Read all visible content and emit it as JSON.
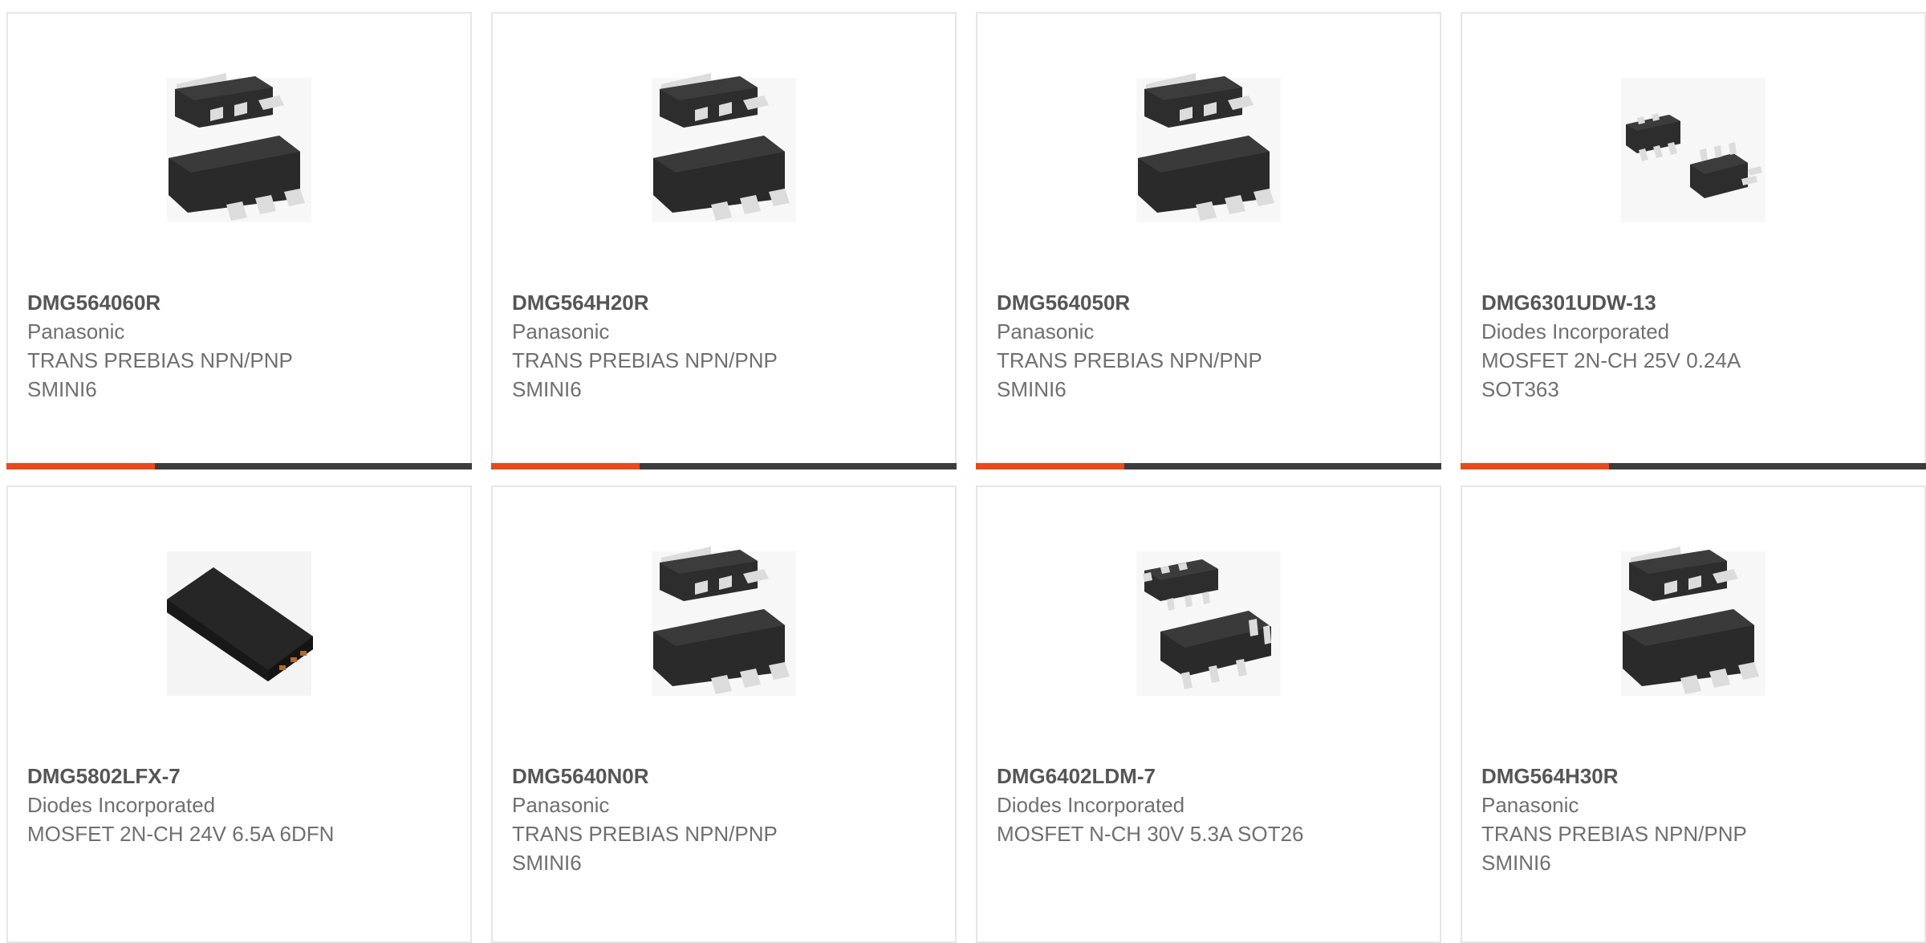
{
  "colors": {
    "accent": "#e8491d",
    "bar_dark": "#3c3c3c",
    "card_border": "#e6e6e6",
    "text_bold": "#555555",
    "text": "#6f6f6f"
  },
  "products": [
    {
      "part_number": "DMG564060R",
      "manufacturer": "Panasonic",
      "description": "TRANS PREBIAS NPN/PNP SMINI6",
      "image_icon": "sot-smini6-package-icon"
    },
    {
      "part_number": "DMG564H20R",
      "manufacturer": "Panasonic",
      "description": "TRANS PREBIAS NPN/PNP SMINI6",
      "image_icon": "sot-smini6-package-icon"
    },
    {
      "part_number": "DMG564050R",
      "manufacturer": "Panasonic",
      "description": "TRANS PREBIAS NPN/PNP SMINI6",
      "image_icon": "sot-smini6-package-icon"
    },
    {
      "part_number": "DMG6301UDW-13",
      "manufacturer": "Diodes Incorporated",
      "description": "MOSFET 2N-CH 25V 0.24A SOT363",
      "image_icon": "sot363-package-icon"
    },
    {
      "part_number": "DMG5802LFX-7",
      "manufacturer": "Diodes Incorporated",
      "description": "MOSFET 2N-CH 24V 6.5A 6DFN",
      "image_icon": "dfn-package-icon"
    },
    {
      "part_number": "DMG5640N0R",
      "manufacturer": "Panasonic",
      "description": "TRANS PREBIAS NPN/PNP SMINI6",
      "image_icon": "sot-smini6-package-icon"
    },
    {
      "part_number": "DMG6402LDM-7",
      "manufacturer": "Diodes Incorporated",
      "description": "MOSFET N-CH 30V 5.3A SOT26",
      "image_icon": "sot26-package-icon"
    },
    {
      "part_number": "DMG564H30R",
      "manufacturer": "Panasonic",
      "description": "TRANS PREBIAS NPN/PNP SMINI6",
      "image_icon": "sot-smini6-package-icon"
    }
  ]
}
